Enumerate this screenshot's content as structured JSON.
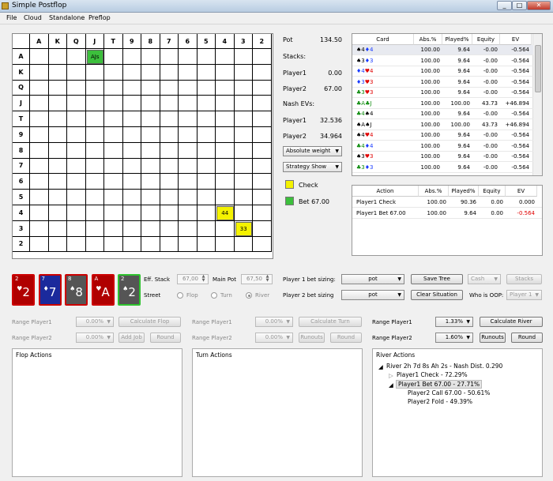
{
  "window": {
    "title": "Simple Postflop",
    "min": "_",
    "max": "□",
    "close": "✕"
  },
  "menu": [
    "File",
    "Cloud",
    "Standalone",
    "Preflop"
  ],
  "grid": {
    "ranks": [
      "A",
      "K",
      "Q",
      "J",
      "T",
      "9",
      "8",
      "7",
      "6",
      "5",
      "4",
      "3",
      "2"
    ],
    "marks": [
      {
        "row": 0,
        "col": 3,
        "label": "AJs",
        "color": "#3cbf3c"
      },
      {
        "row": 10,
        "col": 10,
        "label": "44",
        "color": "#f4f200"
      },
      {
        "row": 11,
        "col": 11,
        "label": "33",
        "color": "#f4f200"
      }
    ]
  },
  "stats": {
    "pot_label": "Pot",
    "pot_value": "134.50",
    "stacks_label": "Stacks:",
    "p1_label": "Player1",
    "p1_stack": "0.00",
    "p2_label": "Player2",
    "p2_stack": "67.00",
    "nash_label": "Nash EVs:",
    "p1_ev_label": "Player1",
    "p1_ev": "32.536",
    "p2_ev_label": "Player2",
    "p2_ev": "34.964",
    "weight_dd": "Absolute weight",
    "strategy_dd": "Strategy Show",
    "legend": [
      {
        "label": "Check",
        "color": "#f4f200"
      },
      {
        "label": "Bet 67.00",
        "color": "#3cbf3c"
      }
    ]
  },
  "card_table": {
    "headers": [
      "Card",
      "Abs.%",
      "Played%",
      "Equity",
      "EV"
    ],
    "rows": [
      {
        "c1": "♠4",
        "c1color": "#000",
        "c2": "♦4",
        "c2color": "#1a3cff",
        "abs": "100.00",
        "played": "9.64",
        "eq": "-0.00",
        "ev": "-0.564"
      },
      {
        "c1": "♠3",
        "c1color": "#000",
        "c2": "♦3",
        "c2color": "#1a3cff",
        "abs": "100.00",
        "played": "9.64",
        "eq": "-0.00",
        "ev": "-0.564"
      },
      {
        "c1": "♦4",
        "c1color": "#1a3cff",
        "c2": "♥4",
        "c2color": "#e00000",
        "abs": "100.00",
        "played": "9.64",
        "eq": "-0.00",
        "ev": "-0.564"
      },
      {
        "c1": "♦3",
        "c1color": "#1a3cff",
        "c2": "♥3",
        "c2color": "#e00000",
        "abs": "100.00",
        "played": "9.64",
        "eq": "-0.00",
        "ev": "-0.564"
      },
      {
        "c1": "♣3",
        "c1color": "#0a8a0a",
        "c2": "♥3",
        "c2color": "#e00000",
        "abs": "100.00",
        "played": "9.64",
        "eq": "-0.00",
        "ev": "-0.564"
      },
      {
        "c1": "♣A",
        "c1color": "#0a8a0a",
        "c2": "♣J",
        "c2color": "#0a8a0a",
        "abs": "100.00",
        "played": "100.00",
        "eq": "43.73",
        "ev": "+46.894"
      },
      {
        "c1": "♣4",
        "c1color": "#0a8a0a",
        "c2": "♠4",
        "c2color": "#000",
        "abs": "100.00",
        "played": "9.64",
        "eq": "-0.00",
        "ev": "-0.564"
      },
      {
        "c1": "♠A",
        "c1color": "#000",
        "c2": "♠J",
        "c2color": "#000",
        "abs": "100.00",
        "played": "100.00",
        "eq": "43.73",
        "ev": "+46.894"
      },
      {
        "c1": "♠4",
        "c1color": "#000",
        "c2": "♥4",
        "c2color": "#e00000",
        "abs": "100.00",
        "played": "9.64",
        "eq": "-0.00",
        "ev": "-0.564"
      },
      {
        "c1": "♣4",
        "c1color": "#0a8a0a",
        "c2": "♦4",
        "c2color": "#1a3cff",
        "abs": "100.00",
        "played": "9.64",
        "eq": "-0.00",
        "ev": "-0.564"
      },
      {
        "c1": "♠3",
        "c1color": "#000",
        "c2": "♥3",
        "c2color": "#e00000",
        "abs": "100.00",
        "played": "9.64",
        "eq": "-0.00",
        "ev": "-0.564"
      },
      {
        "c1": "♣3",
        "c1color": "#0a8a0a",
        "c2": "♦3",
        "c2color": "#1a3cff",
        "abs": "100.00",
        "played": "9.64",
        "eq": "-0.00",
        "ev": "-0.564"
      }
    ]
  },
  "action_table": {
    "headers": [
      "Action",
      "Abs.%",
      "Played%",
      "Equity",
      "EV"
    ],
    "rows": [
      {
        "action": "Player1 Check",
        "abs": "100.00",
        "played": "90.36",
        "eq": "0.00",
        "ev": "0.000",
        "evcolor": "#000"
      },
      {
        "action": "Player1 Bet 67.00",
        "abs": "100.00",
        "played": "9.64",
        "eq": "0.00",
        "ev": "-0.564",
        "evcolor": "#e00000"
      }
    ]
  },
  "board": [
    {
      "rank": "2",
      "suit": "♥",
      "color": "#b00000",
      "border": "#cc0000"
    },
    {
      "rank": "7",
      "suit": "♦",
      "color": "#1b2a9c",
      "border": "#cc0000"
    },
    {
      "rank": "8",
      "suit": "♠",
      "color": "#555555",
      "border": "#cc0000"
    },
    {
      "rank": "A",
      "suit": "♥",
      "color": "#b00000",
      "border": "#cc0000"
    },
    {
      "rank": "2",
      "suit": "♠",
      "color": "#555555",
      "border": "#2fc32f"
    }
  ],
  "controls": {
    "eff_stack_label": "Eff. Stack",
    "eff_stack": "67,00",
    "main_pot_label": "Main Pot",
    "main_pot": "67,50",
    "street_label": "Street",
    "flop": "Flop",
    "turn": "Turn",
    "river": "River",
    "p1_bet_label": "Player 1 bet sizing:",
    "p1_bet": "pot",
    "p2_bet_label": "Player 2 bet sizing",
    "p2_bet": "pot",
    "save_tree": "Save Tree",
    "clear_situation": "Clear Situation",
    "cash": "Cash",
    "stacks": "Stacks",
    "oop_label": "Who is OOP:",
    "oop": "Player 1"
  },
  "range_rows": {
    "flop": {
      "p1": "Range Player1",
      "p1v": "0.00%",
      "p2": "Range Player2",
      "p2v": "0.00%",
      "calc": "Calculate Flop",
      "add": "Add Job",
      "round": "Round"
    },
    "turn": {
      "p1": "Range Player1",
      "p1v": "0.00%",
      "p2": "Range Player2",
      "p2v": "0.00%",
      "calc": "Calculate Turn",
      "runouts": "Runouts",
      "round": "Round"
    },
    "river": {
      "p1": "Range Player1",
      "p1v": "1.33%",
      "p2": "Range Player2",
      "p2v": "1.60%",
      "calc": "Calculate River",
      "runouts": "Runouts",
      "round": "Round"
    }
  },
  "panels": {
    "flop_title": "Flop Actions",
    "turn_title": "Turn Actions",
    "river_title": "River Actions",
    "river_tree": {
      "root": "River 2h 7d 8s Ah 2s - Nash Dist. 0.290",
      "check": "Player1 Check - 72.29%",
      "bet": "Player1 Bet 67.00 - 27.71%",
      "call": "Player2 Call 67.00 - 50.61%",
      "fold": "Player2 Fold - 49.39%"
    }
  }
}
